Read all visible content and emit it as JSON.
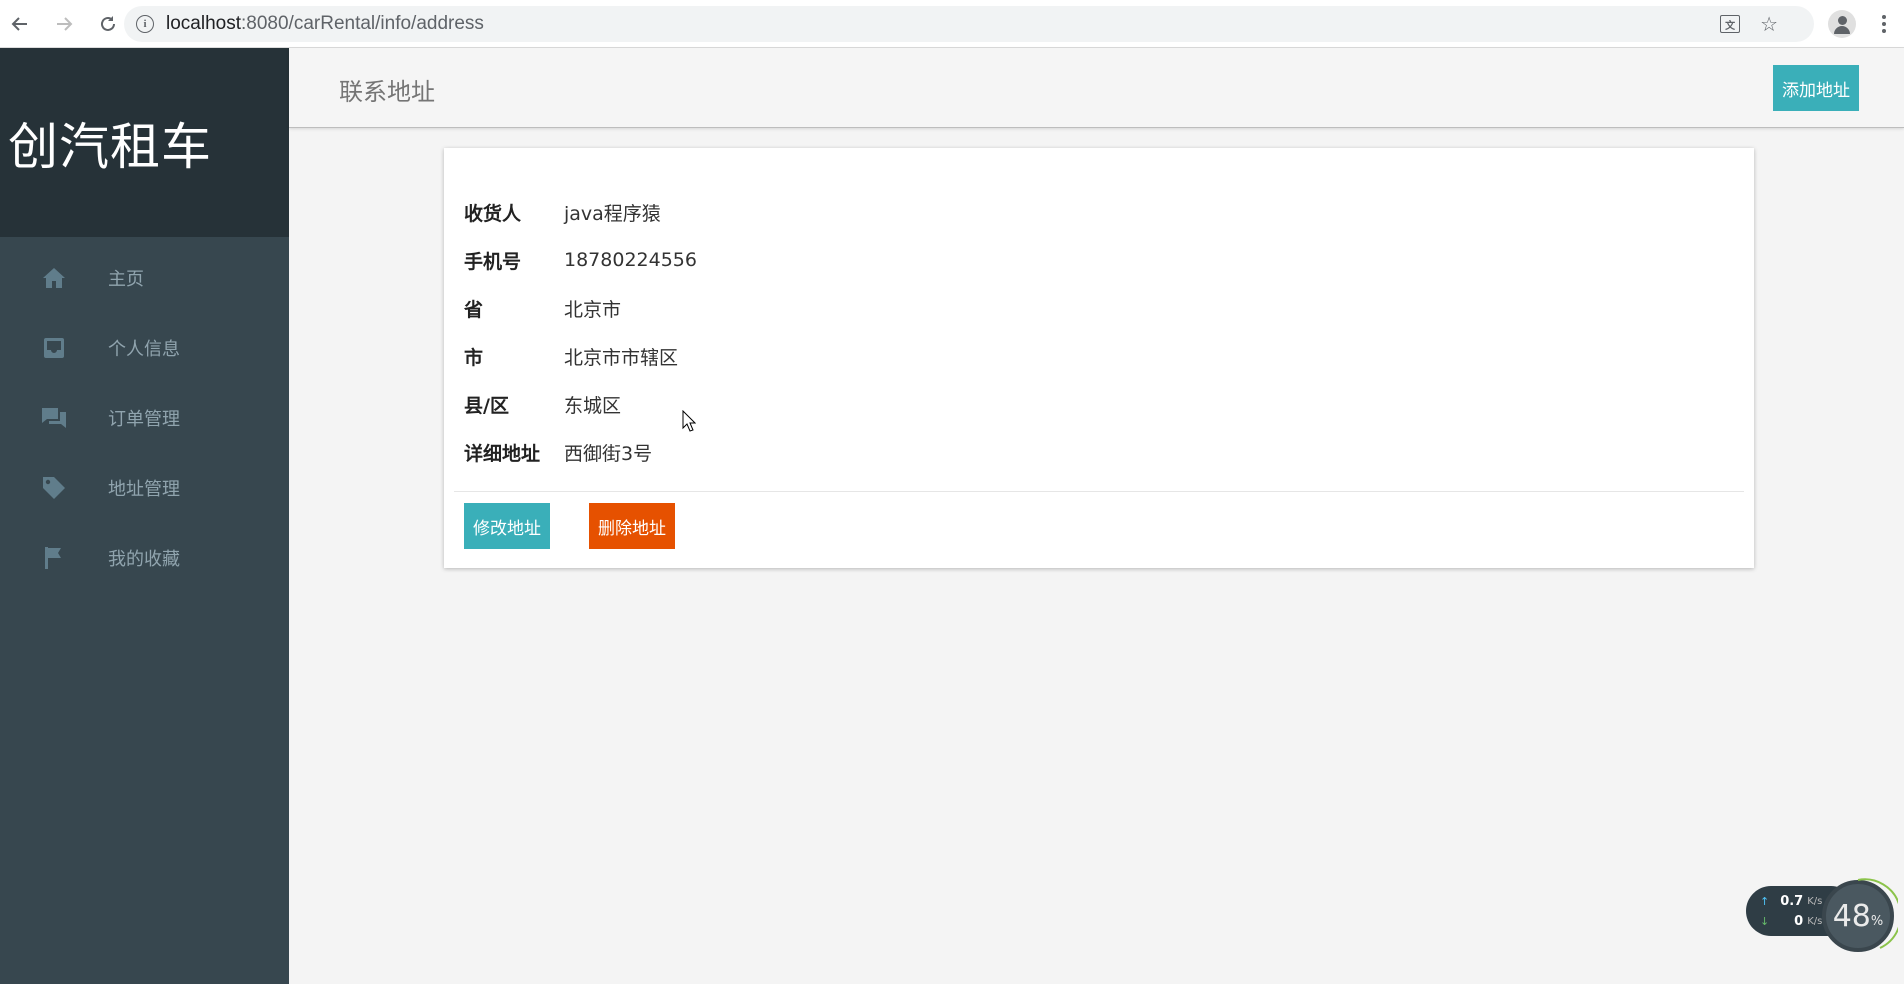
{
  "browser": {
    "url_host": "localhost",
    "url_path": ":8080/carRental/info/address"
  },
  "sidebar": {
    "brand": "创汽租车",
    "items": [
      {
        "label": "主页",
        "icon": "home-icon"
      },
      {
        "label": "个人信息",
        "icon": "inbox-icon"
      },
      {
        "label": "订单管理",
        "icon": "chat-icon"
      },
      {
        "label": "地址管理",
        "icon": "tag-icon"
      },
      {
        "label": "我的收藏",
        "icon": "flag-icon"
      }
    ]
  },
  "header": {
    "title": "联系地址",
    "add_label": "添加地址"
  },
  "address": {
    "fields": [
      {
        "key": "收货人",
        "value": "java程序猿"
      },
      {
        "key": "手机号",
        "value": "18780224556"
      },
      {
        "key": "省",
        "value": "北京市"
      },
      {
        "key": "市",
        "value": "北京市市辖区"
      },
      {
        "key": "县/区",
        "value": "东城区"
      },
      {
        "key": "详细地址",
        "value": "西御街3号"
      }
    ],
    "edit_label": "修改地址",
    "delete_label": "删除地址"
  },
  "speed_widget": {
    "up_value": "0.7",
    "up_unit": "K/s",
    "down_value": "0",
    "down_unit": "K/s",
    "percent_value": "48",
    "percent_sign": "%"
  },
  "colors": {
    "sidebar_bg": "#37474f",
    "brand_bg": "#263238",
    "accent_teal": "#3aafb9",
    "danger_orange": "#e65100"
  }
}
